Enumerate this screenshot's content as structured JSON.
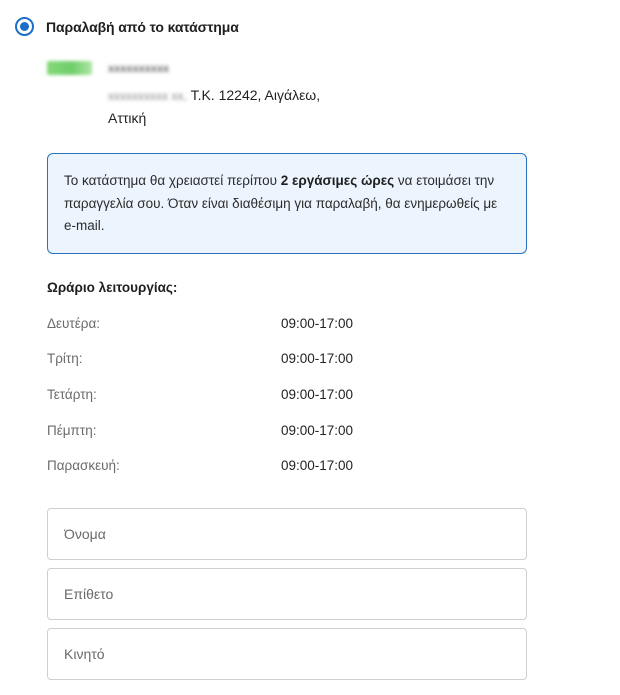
{
  "delivery_option": {
    "label": "Παραλαβή από το κατάστημα",
    "selected": true,
    "accent_color": "#1b6fc9"
  },
  "store": {
    "address_tail": "Τ.Κ. 12242, Αιγάλεω,",
    "region": "Αττική"
  },
  "info": {
    "text_before": "Το κατάστημα θα χρειαστεί περίπου ",
    "emphasis": "2 εργάσιμες ώρες",
    "text_after": " να ετοιμάσει την παραγγελία σου. Όταν είναι διαθέσιμη για παραλαβή, θα ενημερωθείς με e-mail."
  },
  "hours": {
    "title": "Ωράριο λειτουργίας:",
    "rows": [
      {
        "day": "Δευτέρα:",
        "time": "09:00-17:00"
      },
      {
        "day": "Τρίτη:",
        "time": "09:00-17:00"
      },
      {
        "day": "Τετάρτη:",
        "time": "09:00-17:00"
      },
      {
        "day": "Πέμπτη:",
        "time": "09:00-17:00"
      },
      {
        "day": "Παρασκευή:",
        "time": "09:00-17:00"
      }
    ]
  },
  "form": {
    "first_name": {
      "placeholder": "Όνομα",
      "value": ""
    },
    "last_name": {
      "placeholder": "Επίθετο",
      "value": ""
    },
    "mobile": {
      "placeholder": "Κινητό",
      "value": ""
    }
  }
}
